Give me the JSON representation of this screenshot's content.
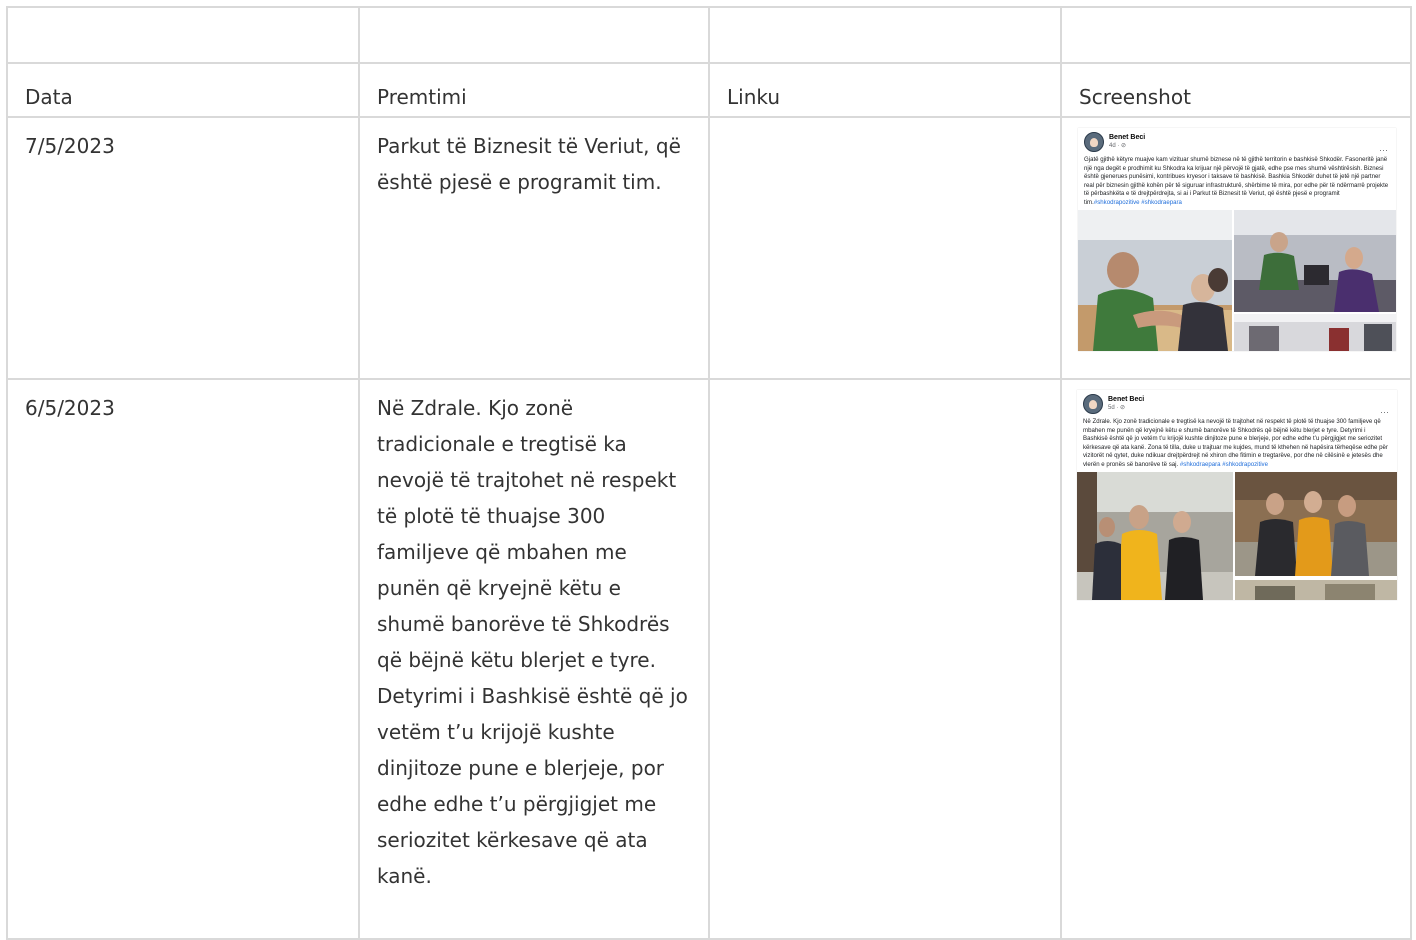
{
  "table": {
    "header_empty": [
      "",
      "",
      "",
      ""
    ],
    "headers": [
      "Data",
      "Premtimi",
      "Linku",
      "Screenshot"
    ],
    "rows": [
      {
        "date": "7/5/2023",
        "promise": "Parkut të Biznesit të Veriut, që është pjesë e programit tim.",
        "link": "",
        "screenshot": {
          "author": "Benet Beci",
          "time": "4d · ⊘",
          "text": "Gjatë gjithë këtyre muajve kam vizituar shumë biznese në të gjithë territorin e bashkisë Shkodër. Fasoneritë janë një nga degët e prodhimit ku Shkodra ka krijuar një përvojë të gjatë, edhe pse mes shumë vështirësish. Biznesi është gjenerues punësimi, kontribues kryesor i taksave të bashkisë. Bashkia Shkodër duhet të jetë një partner real për biznesin gjithë kohën për të siguruar infrastrukturë, shërbime të mira, por edhe për të ndërmarrë projekte të përbashkëta e të drejtpërdrejta, si ai i Parkut të Biznesit të Veriut, që është pjesë e programit tim.",
          "tags": "#shkodrapozitive #shkodraepara"
        }
      },
      {
        "date": "6/5/2023",
        "promise": "Në Zdrale. Kjo zonë tradicionale e tregtisë ka nevojë të trajtohet në respekt të plotë të thuajse 300 familjeve që mbahen me punën që kryejnë këtu e shumë banorëve të Shkodrës që bëjnë këtu blerjet e tyre. Detyrimi i Bashkisë është që jo vetëm t’u krijojë kushte dinjitoze pune e blerjeje, por edhe edhe t’u përgjigjet me seriozitet kërkesave që ata kanë.",
        "link": "",
        "screenshot": {
          "author": "Benet Beci",
          "time": "5d · ⊘",
          "text": "Në Zdrale. Kjo zonë tradicionale e tregtisë ka nevojë të trajtohet në respekt të plotë të thuajse 300 familjeve që mbahen me punën që kryejnë këtu e shumë banorëve të Shkodrës që bëjnë këtu blerjet e tyre. Detyrimi i Bashkisë është që jo vetëm t’u krijojë kushte dinjitoze pune e blerjeje, por edhe edhe t’u përgjigjet me seriozitet kërkesave që ata kanë. Zona të tilla, duke u trajtuar me kujdes, mund të kthehen në hapësira tërheqëse edhe për vizitorët në qytet, duke ndikuar drejtpërdrejt në xhiron dhe fitimin e tregtarëve, por dhe në cilësinë e jetesës dhe vlerën e pronës së banorëve të saj.",
          "tags": "#shkodraepara #shkodrapozitive"
        }
      }
    ]
  },
  "colors": {
    "border": "#d9d9d9",
    "text": "#333333",
    "link": "#216fdb"
  }
}
